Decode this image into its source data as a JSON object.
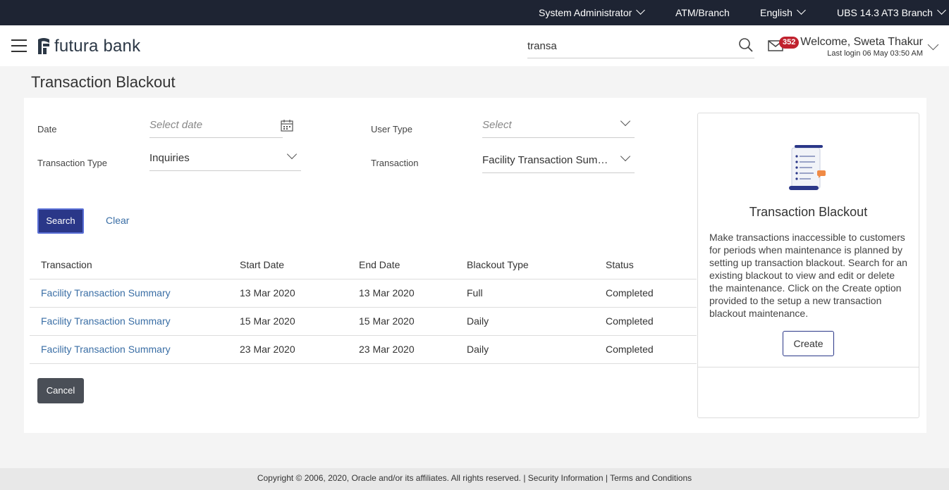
{
  "topbar": {
    "role": "System Administrator",
    "location": "ATM/Branch",
    "language": "English",
    "branch": "UBS 14.3 AT3 Branch"
  },
  "header": {
    "logo_text": "futura bank",
    "search_value": "transa",
    "notification_count": "352",
    "welcome": "Welcome, Sweta Thakur",
    "last_login": "Last login 06 May 03:50 AM"
  },
  "page": {
    "title": "Transaction Blackout"
  },
  "form": {
    "date_label": "Date",
    "date_placeholder": "Select date",
    "user_type_label": "User Type",
    "user_type_placeholder": "Select",
    "transaction_type_label": "Transaction Type",
    "transaction_type_value": "Inquiries",
    "transaction_label": "Transaction",
    "transaction_value": "Facility Transaction Summ..."
  },
  "actions": {
    "search": "Search",
    "clear": "Clear",
    "cancel": "Cancel"
  },
  "table": {
    "headers": [
      "Transaction",
      "Start Date",
      "End Date",
      "Blackout Type",
      "Status"
    ],
    "rows": [
      [
        "Facility Transaction Summary",
        "13 Mar 2020",
        "13 Mar 2020",
        "Full",
        "Completed"
      ],
      [
        "Facility Transaction Summary",
        "15 Mar 2020",
        "15 Mar 2020",
        "Daily",
        "Completed"
      ],
      [
        "Facility Transaction Summary",
        "23 Mar 2020",
        "23 Mar 2020",
        "Daily",
        "Completed"
      ]
    ]
  },
  "help": {
    "title": "Transaction Blackout",
    "text": "Make transactions inaccessible to customers for periods when maintenance is planned by setting up transaction blackout. Search for an existing blackout to view and edit or delete the maintenance. Click on the Create option provided to the setup a new transaction blackout maintenance.",
    "create": "Create"
  },
  "footer": {
    "copyright": "Copyright © 2006, 2020, Oracle and/or its affiliates. All rights reserved.",
    "security": "Security Information",
    "terms": "Terms and Conditions"
  },
  "colors": {
    "topbar": "#1e2433",
    "primary": "#2a3788",
    "link": "#3a6ea5",
    "badge": "#c0222e"
  }
}
